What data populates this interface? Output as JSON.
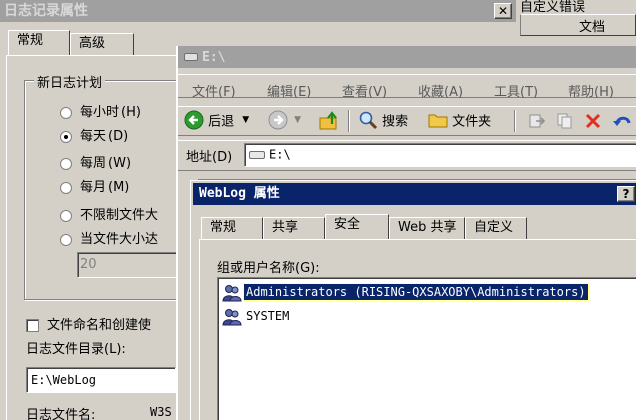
{
  "log_dialog": {
    "title": "日志记录属性",
    "tabs": [
      "常规",
      "高级"
    ],
    "group_label": "新日志计划",
    "schedule_options": [
      {
        "label": "每小时",
        "key": "(H)",
        "checked": false
      },
      {
        "label": "每天",
        "key": "(D)",
        "checked": true
      },
      {
        "label": "每周",
        "key": "(W)",
        "checked": false
      },
      {
        "label": "每月",
        "key": "(M)",
        "checked": false
      },
      {
        "label": "不限制文件大",
        "key": "",
        "checked": false
      },
      {
        "label": "当文件大小达",
        "key": "",
        "checked": false
      }
    ],
    "size_value": "20",
    "naming_checkbox_label": "文件命名和创建使",
    "dir_label": "日志文件目录(L):",
    "dir_value": "E:\\WebLog",
    "filename_label": "日志文件名:",
    "filename_value": "W3S"
  },
  "close_glyph": "✕",
  "error_panel": {
    "title": "自定义错误",
    "column": "文档"
  },
  "explorer": {
    "title": "E:\\",
    "menu": [
      "文件(F)",
      "编辑(E)",
      "查看(V)",
      "收藏(A)",
      "工具(T)",
      "帮助(H)"
    ],
    "toolbar": {
      "back": "后退",
      "search": "搜索",
      "folders": "文件夹"
    },
    "address_label": "地址(D)",
    "address_value": "E:\\"
  },
  "weblog_dialog": {
    "title": "WebLog 属性",
    "help_glyph": "?",
    "tabs": [
      "常规",
      "共享",
      "安全",
      "Web 共享",
      "自定义"
    ],
    "selected_tab": "安全",
    "users_label": "组或用户名称(G):",
    "users": [
      {
        "name": "Administrators (RISING-QXSAXOBY\\Administrators)",
        "selected": true
      },
      {
        "name": "SYSTEM",
        "selected": false
      }
    ]
  },
  "colors": {
    "face": "#d4d0c8",
    "active_title": "#0a246a",
    "inactive_title": "#a0a0a0",
    "selection": "#0a246a"
  }
}
